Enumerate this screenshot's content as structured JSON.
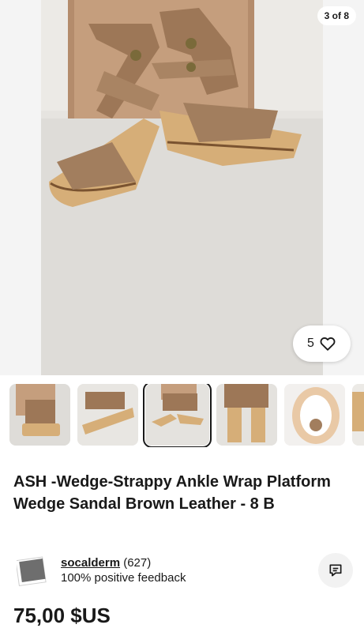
{
  "gallery": {
    "counter": "3 of 8",
    "watch_count": "5",
    "thumbnails": [
      {
        "name": "thumb-1"
      },
      {
        "name": "thumb-2"
      },
      {
        "name": "thumb-3",
        "active": true
      },
      {
        "name": "thumb-4"
      },
      {
        "name": "thumb-5"
      },
      {
        "name": "thumb-6"
      }
    ]
  },
  "listing": {
    "title": "ASH -Wedge-Strappy Ankle Wrap Platform Wedge Sandal Brown Leather - 8 B",
    "price": "75,00 $US"
  },
  "seller": {
    "name": "socalderm",
    "score": "(627)",
    "feedback": "100% positive feedback"
  },
  "icons": {
    "watch": "heart-icon",
    "message": "message-icon"
  },
  "colors": {
    "text": "#191919",
    "leather": "#a27e5e",
    "wood": "#d9b27a"
  }
}
